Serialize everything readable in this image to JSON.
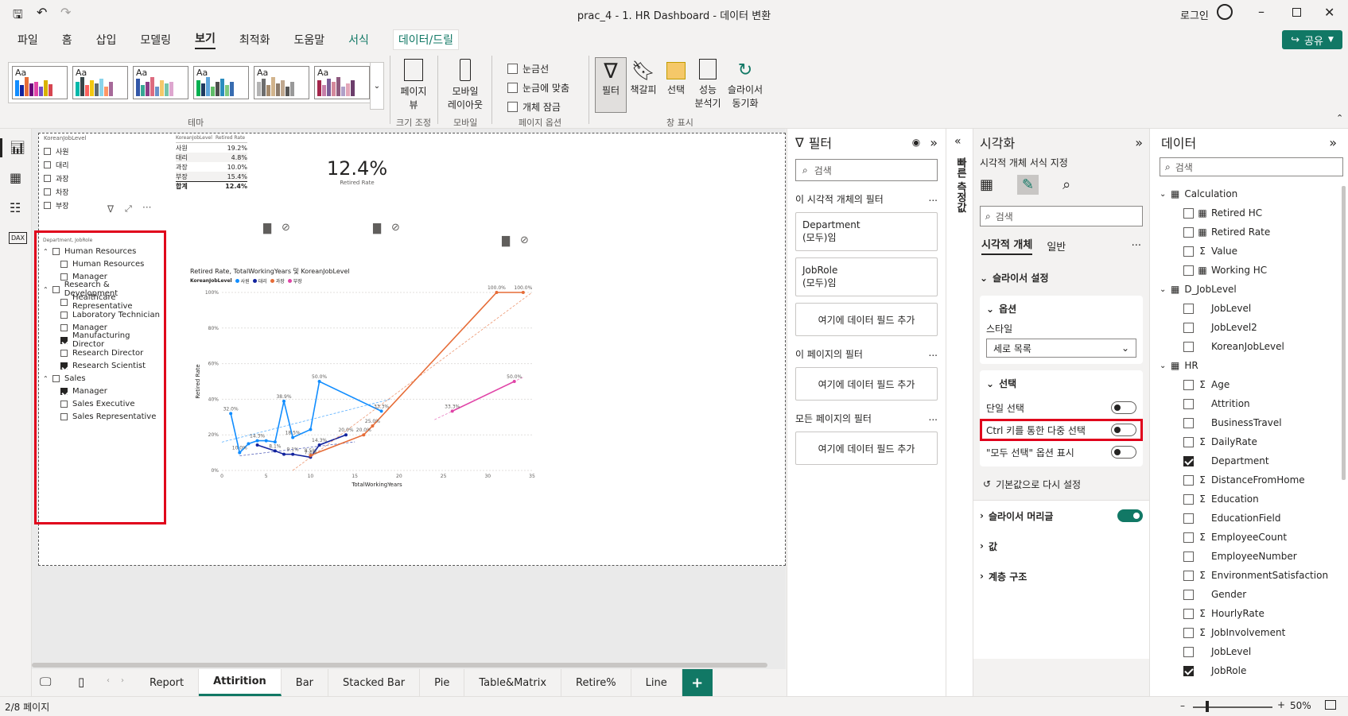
{
  "title": {
    "text": "prac_4 - 1. HR Dashboard - 데이터 변환",
    "login": "로그인",
    "save_icon": "save-icon",
    "undo_icon": "undo-icon",
    "redo_icon": "redo-icon"
  },
  "menu": {
    "items": [
      "파일",
      "홈",
      "삽입",
      "모델링",
      "보기",
      "최적화",
      "도움말",
      "서식",
      "데이터/드릴"
    ],
    "active": "보기",
    "share": "공유"
  },
  "ribbon": {
    "theme_label": "테마",
    "theme_sample": "Aa",
    "page_view": "페이지\n뷰",
    "page_view_l1": "페이지",
    "page_view_l2": "뷰",
    "size_label": "크기 조정",
    "mobile_l1": "모바일",
    "mobile_l2": "레이아웃",
    "mobile_group": "모바일",
    "gridlines": "눈금선",
    "snap": "눈금에 맞춤",
    "lock": "개체 잠금",
    "page_options": "페이지 옵션",
    "filter": "필터",
    "bookmark": "책갈피",
    "selection": "선택",
    "perf_l1": "성능",
    "perf_l2": "분석기",
    "sync_l1": "슬라이서",
    "sync_l2": "동기화",
    "show_pane": "창 표시"
  },
  "table_visual": {
    "slicer_header": "KoreanJobLevel",
    "slicer_items": [
      "사원",
      "대리",
      "과장",
      "차장",
      "부장"
    ],
    "col1": "KoreanJobLevel",
    "col2": "Retired Rate",
    "rows": [
      {
        "level": "사원",
        "rate": "19.2%"
      },
      {
        "level": "대리",
        "rate": "4.8%"
      },
      {
        "level": "과장",
        "rate": "10.0%"
      },
      {
        "level": "부장",
        "rate": "15.4%"
      }
    ],
    "total_label": "합계",
    "total_value": "12.4%"
  },
  "card": {
    "value": "12.4%",
    "label": "Retired Rate"
  },
  "hier_slicer": {
    "header": "Department, JobRole",
    "groups": [
      {
        "name": "Human Resources",
        "children": [
          {
            "name": "Human Resources",
            "checked": false
          },
          {
            "name": "Manager",
            "checked": false
          }
        ]
      },
      {
        "name": "Research & Development",
        "children": [
          {
            "name": "Healthcare Representative",
            "checked": false
          },
          {
            "name": "Laboratory Technician",
            "checked": false
          },
          {
            "name": "Manager",
            "checked": false
          },
          {
            "name": "Manufacturing Director",
            "checked": true
          },
          {
            "name": "Research Director",
            "checked": false
          },
          {
            "name": "Research Scientist",
            "checked": true
          }
        ]
      },
      {
        "name": "Sales",
        "children": [
          {
            "name": "Manager",
            "checked": true
          },
          {
            "name": "Sales Executive",
            "checked": false
          },
          {
            "name": "Sales Representative",
            "checked": false
          }
        ]
      }
    ]
  },
  "chart_data": {
    "type": "line",
    "title": "Retired Rate, TotalWorkingYears 및 KoreanJobLevel",
    "legend_title": "KoreanJobLevel",
    "legend_position": "top-left",
    "xlabel": "TotalWorkingYears",
    "ylabel": "Retired Rate",
    "xlim": [
      0,
      35
    ],
    "ylim": [
      0,
      100
    ],
    "x_ticks": [
      0,
      5,
      10,
      15,
      20,
      25,
      30,
      35
    ],
    "y_ticks": [
      "0%",
      "20%",
      "40%",
      "60%",
      "80%",
      "100%"
    ],
    "grid": true,
    "series": [
      {
        "name": "사원",
        "color": "#118DFF",
        "x": [
          1,
          2,
          3,
          4,
          5,
          6,
          7,
          8,
          10,
          11,
          18
        ],
        "y": [
          32.0,
          10.0,
          15.0,
          16.7,
          16.7,
          16.0,
          38.9,
          18.5,
          23.0,
          50.0,
          33.3
        ]
      },
      {
        "name": "대리",
        "color": "#12239E",
        "x": [
          4,
          6,
          7,
          8,
          10,
          11,
          14
        ],
        "y": [
          14.3,
          11.0,
          9.1,
          9.1,
          7.4,
          14.3,
          20.0
        ]
      },
      {
        "name": "과장",
        "color": "#E66C37",
        "x": [
          10,
          16,
          17,
          31,
          34
        ],
        "y": [
          8.5,
          20.0,
          25.0,
          100.0,
          100.0
        ]
      },
      {
        "name": "부장",
        "color": "#E044A7",
        "x": [
          26,
          33
        ],
        "y": [
          33.3,
          50.0
        ]
      }
    ],
    "data_labels": [
      {
        "x": 1,
        "y": 32.0,
        "text": "32.0%"
      },
      {
        "x": 2,
        "y": 10.0,
        "text": "10.0%"
      },
      {
        "x": 4,
        "y": 16.7,
        "text": "14.3%"
      },
      {
        "x": 7,
        "y": 38.9,
        "text": "38.9%"
      },
      {
        "x": 8,
        "y": 18.5,
        "text": "18.5%"
      },
      {
        "x": 11,
        "y": 50.0,
        "text": "50.0%"
      },
      {
        "x": 11,
        "y": 14.3,
        "text": "14.3%"
      },
      {
        "x": 14,
        "y": 20.0,
        "text": "20.0%"
      },
      {
        "x": 18,
        "y": 33.3,
        "text": "33.3%"
      },
      {
        "x": 17,
        "y": 25.0,
        "text": "25.0%"
      },
      {
        "x": 16,
        "y": 20.0,
        "text": "20.0%"
      },
      {
        "x": 6,
        "y": 11.0,
        "text": "8.1%"
      },
      {
        "x": 8,
        "y": 9.1,
        "text": "9.1%"
      },
      {
        "x": 10,
        "y": 7.4,
        "text": "7.4%"
      },
      {
        "x": 10,
        "y": 8.5,
        "text": "8.5%"
      },
      {
        "x": 26,
        "y": 33.3,
        "text": "33.3%"
      },
      {
        "x": 33,
        "y": 50.0,
        "text": "50.0%"
      },
      {
        "x": 31,
        "y": 100.0,
        "text": "100.0%"
      },
      {
        "x": 34,
        "y": 100.0,
        "text": "100.0%"
      }
    ]
  },
  "filters_pane": {
    "title": "필터",
    "search": "검색",
    "visual_filters": "이 시각적 개체의 필터",
    "page_filters": "이 페이지의 필터",
    "all_filters": "모든 페이지의 필터",
    "add_field": "여기에 데이터 필드 추가",
    "more": "...",
    "cards": [
      {
        "field": "Department",
        "state": "(모두)임"
      },
      {
        "field": "JobRole",
        "state": "(모두)임"
      }
    ]
  },
  "quick_measure": "빠른 측정값",
  "viz_pane": {
    "title": "시각화",
    "subtitle": "시각적 개체 서식 지정",
    "search": "검색",
    "tab_visual": "시각적 개체",
    "tab_general": "일반",
    "more": "···",
    "slicer_settings": "슬라이서 설정",
    "options": "옵션",
    "style_label": "스타일",
    "style_value": "세로 목록",
    "selection": "선택",
    "single_select": "단일 선택",
    "ctrl_multi": "Ctrl 키를 통한 다중 선택",
    "show_select_all": "\"모두 선택\" 옵션 표시",
    "reset": "기본값으로 다시 설정",
    "slicer_header": "슬라이서 머리글",
    "values": "값",
    "hierarchy": "계층 구조"
  },
  "data_pane": {
    "title": "데이터",
    "search": "검색",
    "tables": [
      {
        "name": "Calculation",
        "fields": [
          {
            "name": "Retired HC",
            "kind": "calc",
            "checked": false
          },
          {
            "name": "Retired Rate",
            "kind": "calc",
            "checked": false
          },
          {
            "name": "Value",
            "kind": "sum",
            "checked": false
          },
          {
            "name": "Working HC",
            "kind": "calc",
            "checked": false
          }
        ]
      },
      {
        "name": "D_JobLevel",
        "fields": [
          {
            "name": "JobLevel",
            "kind": "",
            "checked": false
          },
          {
            "name": "JobLevel2",
            "kind": "",
            "checked": false
          },
          {
            "name": "KoreanJobLevel",
            "kind": "",
            "checked": false
          }
        ]
      },
      {
        "name": "HR",
        "fields": [
          {
            "name": "Age",
            "kind": "sum",
            "checked": false
          },
          {
            "name": "Attrition",
            "kind": "",
            "checked": false
          },
          {
            "name": "BusinessTravel",
            "kind": "",
            "checked": false
          },
          {
            "name": "DailyRate",
            "kind": "sum",
            "checked": false
          },
          {
            "name": "Department",
            "kind": "",
            "checked": true
          },
          {
            "name": "DistanceFromHome",
            "kind": "sum",
            "checked": false
          },
          {
            "name": "Education",
            "kind": "sum",
            "checked": false
          },
          {
            "name": "EducationField",
            "kind": "",
            "checked": false
          },
          {
            "name": "EmployeeCount",
            "kind": "sum",
            "checked": false
          },
          {
            "name": "EmployeeNumber",
            "kind": "",
            "checked": false
          },
          {
            "name": "EnvironmentSatisfaction",
            "kind": "sum",
            "checked": false
          },
          {
            "name": "Gender",
            "kind": "",
            "checked": false
          },
          {
            "name": "HourlyRate",
            "kind": "sum",
            "checked": false
          },
          {
            "name": "JobInvolvement",
            "kind": "sum",
            "checked": false
          },
          {
            "name": "JobLevel",
            "kind": "",
            "checked": false
          },
          {
            "name": "JobRole",
            "kind": "",
            "checked": true
          }
        ]
      }
    ]
  },
  "tabs": {
    "items": [
      "Report",
      "Attirition",
      "Bar",
      "Stacked Bar",
      "Pie",
      "Table&Matrix",
      "Retire%",
      "Line"
    ],
    "active": "Attirition",
    "add": "+"
  },
  "status": {
    "page": "2/8 페이지",
    "zoom": "50%"
  }
}
